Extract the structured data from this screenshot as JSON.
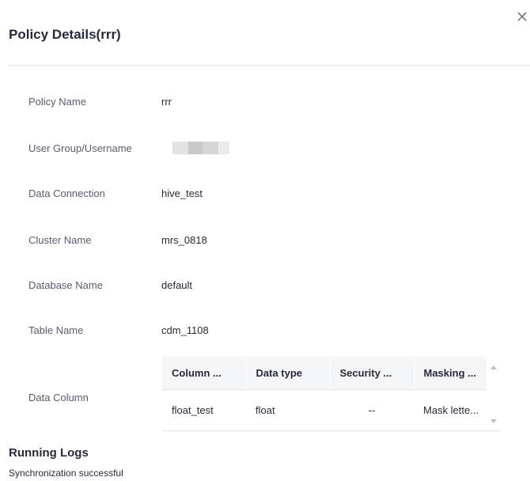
{
  "dialog": {
    "title": "Policy Details(rrr)",
    "close_icon": "close-icon"
  },
  "fields": [
    {
      "label": "Policy Name",
      "value": "rrr"
    },
    {
      "label": "User Group/Username",
      "value": ""
    },
    {
      "label": "Data Connection",
      "value": "hive_test"
    },
    {
      "label": "Cluster Name",
      "value": "mrs_0818"
    },
    {
      "label": "Database Name",
      "value": "default"
    },
    {
      "label": "Table Name",
      "value": "cdm_1108"
    },
    {
      "label": "Data Column",
      "value": ""
    }
  ],
  "column_table": {
    "headers": [
      "Column ...",
      "Data type",
      "Security ...",
      "Masking ..."
    ],
    "rows": [
      [
        "float_test",
        "float",
        "--",
        "Mask lette..."
      ]
    ]
  },
  "running_logs": {
    "title": "Running Logs",
    "message": "Synchronization successful"
  }
}
